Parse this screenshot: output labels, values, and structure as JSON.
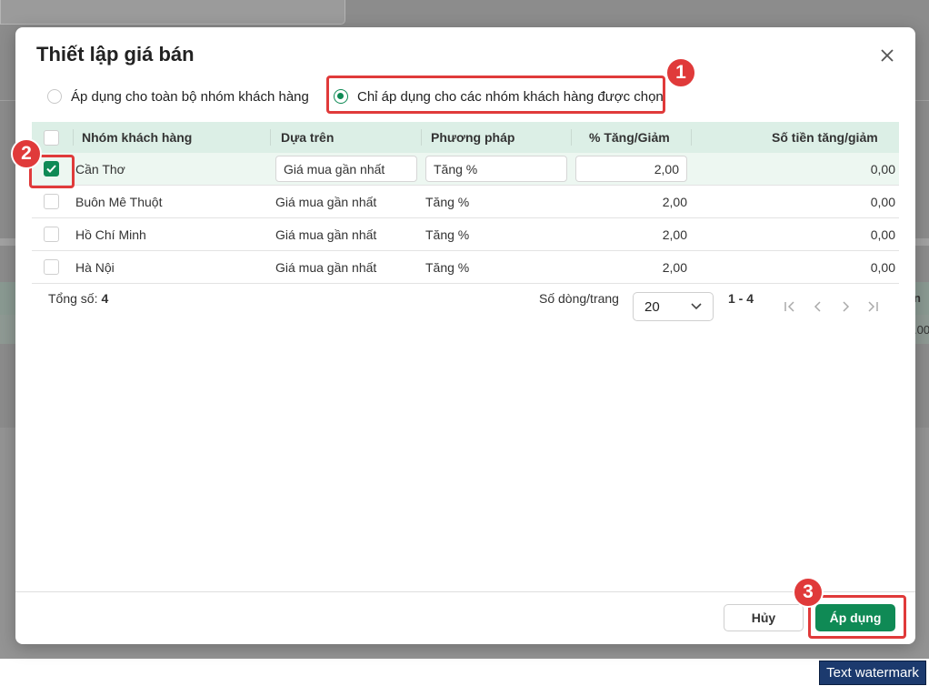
{
  "modal": {
    "title": "Thiết lập giá bán",
    "radio_all_label": "Áp dụng cho toàn bộ nhóm khách hàng",
    "radio_selected_label": "Chỉ áp dụng cho các nhóm khách hàng được chọn",
    "selected_option": "selected_groups"
  },
  "table": {
    "headers": {
      "group": "Nhóm khách hàng",
      "based_on": "Dựa trên",
      "method": "Phương pháp",
      "percent": "% Tăng/Giảm",
      "amount": "Số tiền tăng/giảm"
    },
    "rows": [
      {
        "group": "Cần Thơ",
        "based_on": "Giá mua gần nhất",
        "method": "Tăng %",
        "percent": "2,00",
        "amount": "0,00",
        "checked": true
      },
      {
        "group": "Buôn Mê Thuột",
        "based_on": "Giá mua gần nhất",
        "method": "Tăng %",
        "percent": "2,00",
        "amount": "0,00",
        "checked": false
      },
      {
        "group": "Hồ Chí Minh",
        "based_on": "Giá mua gần nhất",
        "method": "Tăng %",
        "percent": "2,00",
        "amount": "0,00",
        "checked": false
      },
      {
        "group": "Hà Nội",
        "based_on": "Giá mua gần nhất",
        "method": "Tăng %",
        "percent": "2,00",
        "amount": "0,00",
        "checked": false
      }
    ]
  },
  "pagination": {
    "total_label": "Tổng số:",
    "total_value": "4",
    "rows_per_page_label": "Số dòng/trang",
    "rows_per_page_value": "20",
    "range": "1 - 4"
  },
  "footer": {
    "cancel_label": "Hủy",
    "apply_label": "Áp dụng"
  },
  "annotations": {
    "step1": "1",
    "step2": "2",
    "step3": "3"
  },
  "background": {
    "side_text_1": "n",
    "side_text_2": ".00"
  },
  "watermark": "Text watermark",
  "colors": {
    "accent": "#0f8a55",
    "highlight": "#e03a3a",
    "header_bg": "#dcefe6"
  }
}
